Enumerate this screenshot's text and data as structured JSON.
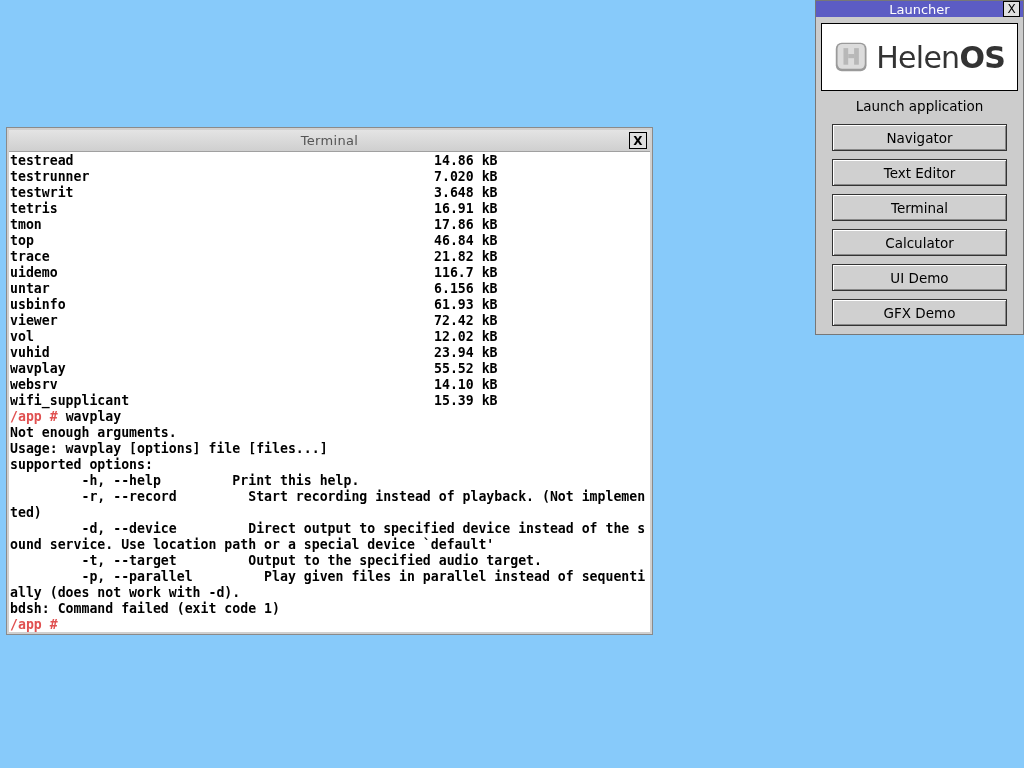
{
  "terminal": {
    "title": "Terminal",
    "close": "X",
    "lines": [
      {
        "kind": "file",
        "name": "testread",
        "size": "14.86 kB"
      },
      {
        "kind": "file",
        "name": "testrunner",
        "size": "7.020 kB"
      },
      {
        "kind": "file",
        "name": "testwrit",
        "size": "3.648 kB"
      },
      {
        "kind": "file",
        "name": "tetris",
        "size": "16.91 kB"
      },
      {
        "kind": "file",
        "name": "tmon",
        "size": "17.86 kB"
      },
      {
        "kind": "file",
        "name": "top",
        "size": "46.84 kB"
      },
      {
        "kind": "file",
        "name": "trace",
        "size": "21.82 kB"
      },
      {
        "kind": "file",
        "name": "uidemo",
        "size": "116.7 kB"
      },
      {
        "kind": "file",
        "name": "untar",
        "size": "6.156 kB"
      },
      {
        "kind": "file",
        "name": "usbinfo",
        "size": "61.93 kB"
      },
      {
        "kind": "file",
        "name": "viewer",
        "size": "72.42 kB"
      },
      {
        "kind": "file",
        "name": "vol",
        "size": "12.02 kB"
      },
      {
        "kind": "file",
        "name": "vuhid",
        "size": "23.94 kB"
      },
      {
        "kind": "file",
        "name": "wavplay",
        "size": "55.52 kB"
      },
      {
        "kind": "file",
        "name": "websrv",
        "size": "14.10 kB"
      },
      {
        "kind": "file",
        "name": "wifi_supplicant",
        "size": "15.39 kB"
      },
      {
        "kind": "prompt",
        "path": "/app",
        "symbol": "#",
        "command": "wavplay"
      },
      {
        "kind": "output",
        "text": "Not enough arguments."
      },
      {
        "kind": "output",
        "text": "Usage: wavplay [options] file [files...]"
      },
      {
        "kind": "output",
        "text": "supported options:"
      },
      {
        "kind": "output",
        "text": "         -h, --help         Print this help."
      },
      {
        "kind": "output",
        "text": "         -r, --record         Start recording instead of playback. (Not implemen"
      },
      {
        "kind": "output",
        "text": "ted)"
      },
      {
        "kind": "output",
        "text": "         -d, --device         Direct output to specified device instead of the s"
      },
      {
        "kind": "output",
        "text": "ound service. Use location path or a special device `default'"
      },
      {
        "kind": "output",
        "text": "         -t, --target         Output to the specified audio target."
      },
      {
        "kind": "output",
        "text": "         -p, --parallel         Play given files in parallel instead of sequenti"
      },
      {
        "kind": "output",
        "text": "ally (does not work with -d)."
      },
      {
        "kind": "output",
        "text": "bdsh: Command failed (exit code 1)"
      },
      {
        "kind": "prompt",
        "path": "/app",
        "symbol": "#"
      }
    ]
  },
  "launcher": {
    "title": "Launcher",
    "close": "X",
    "logo_text": "Helen**OS**",
    "heading": "Launch application",
    "buttons": [
      "Navigator",
      "Text Editor",
      "Terminal",
      "Calculator",
      "UI Demo",
      "GFX Demo"
    ]
  }
}
